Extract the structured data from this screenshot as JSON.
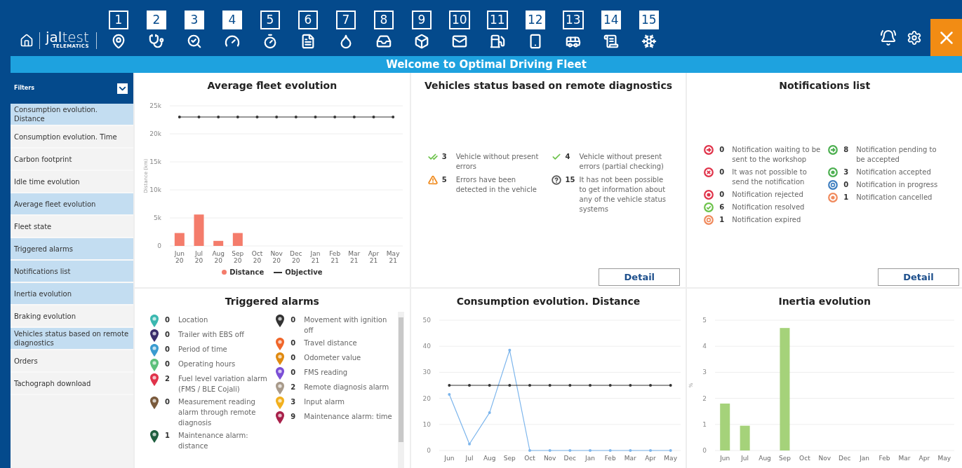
{
  "header": {
    "logo": "**jal**test",
    "logo_sub": "TELEMATICS",
    "tools": [
      {
        "badge": "1",
        "filled": false,
        "kind": "pin"
      },
      {
        "badge": "2",
        "filled": true,
        "kind": "stethoscope"
      },
      {
        "badge": "3",
        "filled": true,
        "kind": "search-chart"
      },
      {
        "badge": "4",
        "filled": true,
        "kind": "gauge"
      },
      {
        "badge": "5",
        "filled": false,
        "kind": "timer"
      },
      {
        "badge": "6",
        "filled": false,
        "kind": "document"
      },
      {
        "badge": "7",
        "filled": false,
        "kind": "oil"
      },
      {
        "badge": "8",
        "filled": false,
        "kind": "tray"
      },
      {
        "badge": "9",
        "filled": false,
        "kind": "cube"
      },
      {
        "badge": "10",
        "filled": false,
        "kind": "mail"
      },
      {
        "badge": "11",
        "filled": false,
        "kind": "fuel"
      },
      {
        "badge": "12",
        "filled": true,
        "kind": "phone-alert"
      },
      {
        "badge": "13",
        "filled": false,
        "kind": "trucks"
      },
      {
        "badge": "14",
        "filled": true,
        "kind": "list"
      },
      {
        "badge": "15",
        "filled": true,
        "kind": "snowflake"
      }
    ]
  },
  "banner": "Welcome to Optimal Driving Fleet",
  "sidebar": {
    "title": "Filters",
    "items": [
      {
        "label": "Consumption evolution. Distance",
        "selected": true
      },
      {
        "label": "Consumption evolution. Time",
        "selected": false
      },
      {
        "label": "Carbon footprint",
        "selected": false
      },
      {
        "label": "Idle time evolution",
        "selected": false
      },
      {
        "label": "Average fleet evolution",
        "selected": true
      },
      {
        "label": "Fleet state",
        "selected": false
      },
      {
        "label": "Triggered alarms",
        "selected": true
      },
      {
        "label": "Notifications list",
        "selected": true
      },
      {
        "label": "Inertia evolution",
        "selected": true
      },
      {
        "label": "Braking evolution",
        "selected": false
      },
      {
        "label": "Vehicles status based on remote diagnostics",
        "selected": true
      },
      {
        "label": "Orders",
        "selected": false
      },
      {
        "label": "Tachograph download",
        "selected": false
      }
    ]
  },
  "average_fleet": {
    "title": "Average fleet evolution",
    "chart_data": {
      "type": "bar",
      "ylabel": "Distance (km)",
      "categories": [
        "Jun 20",
        "Jul 20",
        "Aug 20",
        "Sep 20",
        "Oct 20",
        "Nov 20",
        "Dec 20",
        "Jan 21",
        "Feb 21",
        "Mar 21",
        "Apr 21",
        "May 21"
      ],
      "grid": true,
      "series": [
        {
          "name": "Distance",
          "color": "#f47c6b",
          "values": [
            2300,
            5600,
            900,
            2300,
            0,
            0,
            0,
            0,
            0,
            0,
            0,
            0
          ]
        },
        {
          "name": "Objective",
          "color": "#333333",
          "type": "line",
          "values": [
            23000,
            23000,
            23000,
            23000,
            23000,
            23000,
            23000,
            23000,
            23000,
            23000,
            23000,
            23000
          ]
        }
      ],
      "ylim": [
        0,
        25000
      ],
      "yticks": [
        {
          "value": 0,
          "label": "0"
        },
        {
          "value": 5000,
          "label": "5k"
        },
        {
          "value": 10000,
          "label": "10k"
        },
        {
          "value": 15000,
          "label": "15k"
        },
        {
          "value": 20000,
          "label": "20k"
        },
        {
          "value": 25000,
          "label": "25k"
        }
      ]
    }
  },
  "vehicle_status": {
    "title": "Vehicles status based on remote diagnostics",
    "detail": "Detail",
    "columns": [
      [
        {
          "kind": "double-check",
          "count": "3",
          "label": "Vehicle without present errors"
        },
        {
          "kind": "warning",
          "count": "5",
          "label": "Errors have been detected in the vehicle"
        }
      ],
      [
        {
          "kind": "check",
          "count": "4",
          "label": "Vehicle without present errors (partial checking)"
        },
        {
          "kind": "question",
          "count": "15",
          "label": "It has not been possible to get information about any of the vehicle status systems"
        }
      ]
    ]
  },
  "notifications": {
    "title": "Notifications list",
    "detail": "Detail",
    "columns": [
      [
        {
          "count": "0",
          "label": "Notification waiting to be sent to the workshop",
          "color": "#e0334a",
          "kind": "arrow"
        },
        {
          "count": "0",
          "label": "It was not possible to send the notification",
          "color": "#e0334a",
          "kind": "cross"
        },
        {
          "count": "0",
          "label": "Notification rejected",
          "color": "#e0334a",
          "kind": "dot"
        },
        {
          "count": "6",
          "label": "Notification resolved",
          "color": "#6cc24a",
          "kind": "check"
        },
        {
          "count": "1",
          "label": "Notification expired",
          "color": "#f08a5d",
          "kind": "ring"
        }
      ],
      [
        {
          "count": "8",
          "label": "Notification pending to be accepted",
          "color": "#4caf50",
          "kind": "arrow"
        },
        {
          "count": "3",
          "label": "Notification accepted",
          "color": "#4caf50",
          "kind": "dot"
        },
        {
          "count": "0",
          "label": "Notification in progress",
          "color": "#3f7fc0",
          "kind": "ring"
        },
        {
          "count": "1",
          "label": "Notification cancelled",
          "color": "#f08a5d",
          "kind": "dot"
        }
      ]
    ]
  },
  "alarms": {
    "title": "Triggered alarms",
    "columns": [
      [
        {
          "count": "0",
          "label": "Location",
          "color": "#3bb8b0"
        },
        {
          "count": "0",
          "label": "Trailer with EBS off",
          "color": "#3a2d6b"
        },
        {
          "count": "0",
          "label": "Period of time",
          "color": "#3a9bd0"
        },
        {
          "count": "0",
          "label": "Operating hours",
          "color": "#5cc07a"
        },
        {
          "count": "2",
          "label": "Fuel level variation alarm (FMS / BLE Cojali)",
          "color": "#e0334a"
        },
        {
          "count": "0",
          "label": "Measurement reading alarm through remote diagnosis",
          "color": "#7a5a3c"
        },
        {
          "count": "1",
          "label": "Maintenance alarm: distance",
          "color": "#1f5e3f"
        }
      ],
      [
        {
          "count": "0",
          "label": "Movement with ignition off",
          "color": "#333333"
        },
        {
          "count": "0",
          "label": "Travel distance",
          "color": "#f0662a"
        },
        {
          "count": "0",
          "label": "Odometer value",
          "color": "#e08a10"
        },
        {
          "count": "0",
          "label": "FMS reading",
          "color": "#7b4fd6"
        },
        {
          "count": "2",
          "label": "Remote diagnosis alarm",
          "color": "#a89a8a"
        },
        {
          "count": "3",
          "label": "Input alarm",
          "color": "#f2b01e"
        },
        {
          "count": "9",
          "label": "Maintenance alarm: time",
          "color": "#a8204a"
        }
      ]
    ]
  },
  "consumption": {
    "title": "Consumption evolution. Distance",
    "chart_data": {
      "type": "line",
      "categories": [
        "Jun",
        "Jul",
        "Aug",
        "Sep",
        "Oct",
        "Nov",
        "Dec",
        "Jan",
        "Feb",
        "Mar",
        "Apr",
        "May"
      ],
      "grid": true,
      "series": [
        {
          "color": "#7cb5ec",
          "values": [
            21.5,
            2.5,
            14.5,
            38.5,
            0,
            0,
            0,
            0,
            0,
            0,
            0,
            0
          ]
        },
        {
          "color": "#333333",
          "values": [
            25,
            25,
            25,
            25,
            25,
            25,
            25,
            25,
            25,
            25,
            25,
            25
          ]
        }
      ],
      "ylim": [
        0,
        50
      ],
      "yticks": [
        0,
        10,
        20,
        30,
        40,
        50
      ]
    }
  },
  "inertia": {
    "title": "Inertia evolution",
    "chart_data": {
      "type": "bar",
      "ylabel": "%",
      "categories": [
        "Jun",
        "Jul",
        "Aug",
        "Sep",
        "Oct",
        "Nov",
        "Dec",
        "Jan",
        "Feb",
        "Mar",
        "Apr",
        "May"
      ],
      "grid": true,
      "series": [
        {
          "color": "#a5d27a",
          "values": [
            1.8,
            0.95,
            0,
            4.7,
            0,
            0,
            0,
            0,
            0,
            0,
            0,
            0
          ]
        }
      ],
      "ylim": [
        0,
        5
      ],
      "yticks": [
        0,
        1,
        2,
        3,
        4,
        5
      ]
    }
  }
}
